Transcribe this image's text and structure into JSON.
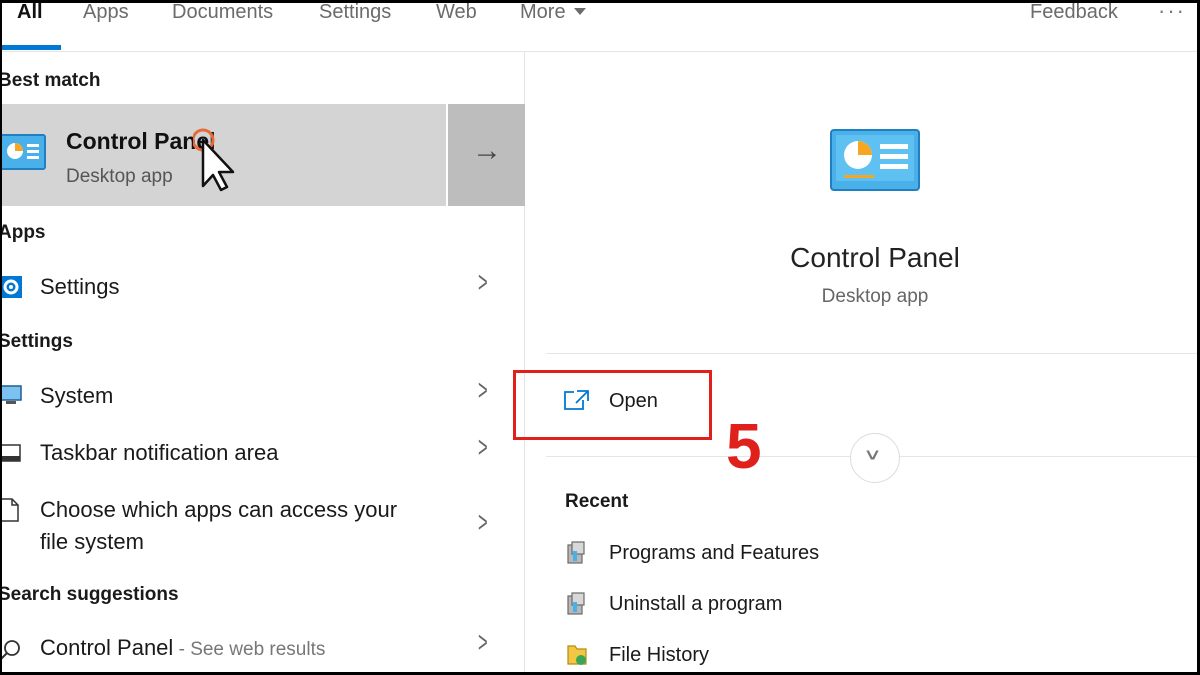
{
  "tabs": {
    "all": "All",
    "apps": "Apps",
    "documents": "Documents",
    "settings": "Settings",
    "web": "Web",
    "more": "More",
    "feedback": "Feedback",
    "options": "···"
  },
  "left": {
    "best_match_label": "Best match",
    "best_match": {
      "title": "Control Panel",
      "subtitle": "Desktop app"
    },
    "apps_label": "Apps",
    "apps": [
      {
        "label": "Settings"
      }
    ],
    "settings_label": "Settings",
    "settings": [
      {
        "label": "System"
      },
      {
        "label": "Taskbar notification area"
      },
      {
        "label_line1": "Choose which apps can access your",
        "label_line2": "file system"
      }
    ],
    "suggestions_label": "Search suggestions",
    "suggestions": [
      {
        "label": "Control Panel",
        "hint": " - See web results"
      }
    ]
  },
  "right": {
    "title": "Control Panel",
    "subtitle": "Desktop app",
    "open_label": "Open",
    "step_number": "5",
    "recent_label": "Recent",
    "recent": [
      {
        "label": "Programs and Features",
        "icon": "programs-icon"
      },
      {
        "label": "Uninstall a program",
        "icon": "programs-icon"
      },
      {
        "label": "File History",
        "icon": "file-history-icon"
      }
    ]
  },
  "colors": {
    "accent": "#0078d4",
    "highlight_box": "#e0201b",
    "selected_bg": "#d4d4d4",
    "selected_arrow_bg": "#bdbdbd"
  }
}
